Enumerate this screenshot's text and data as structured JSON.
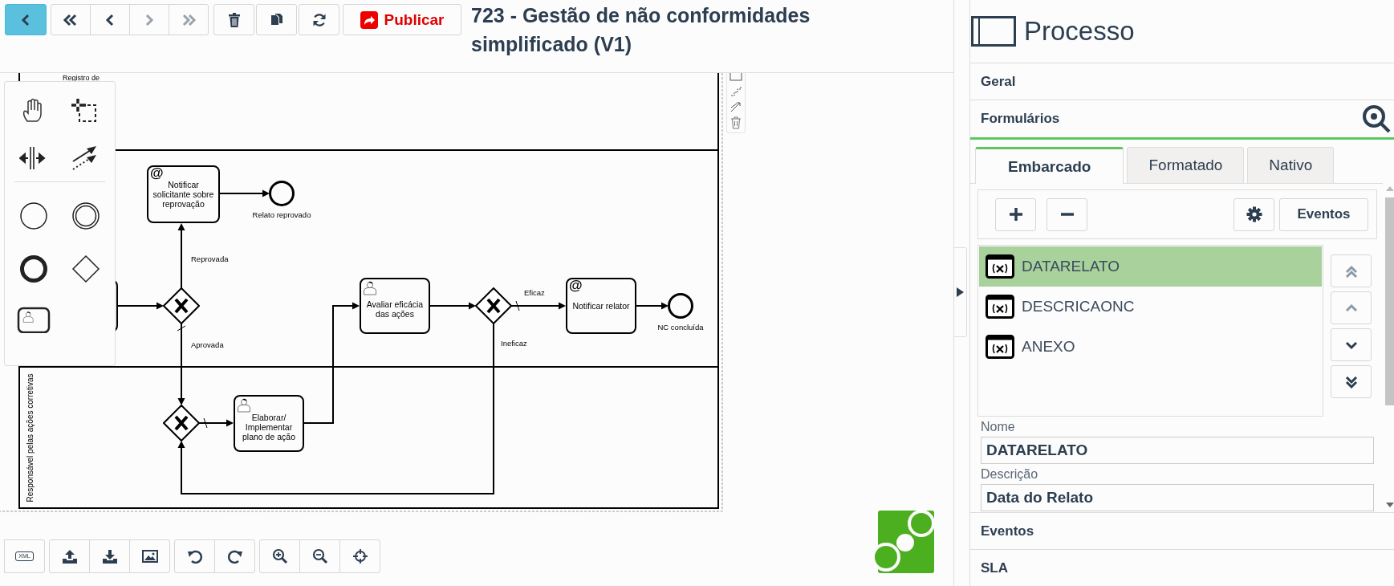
{
  "toolbar": {
    "nav_buttons": [
      {
        "kind": "first",
        "disabled": false
      },
      {
        "kind": "previous",
        "disabled": false
      },
      {
        "kind": "next",
        "disabled": true
      },
      {
        "kind": "last",
        "disabled": true
      }
    ],
    "publish_label": "Publicar"
  },
  "title": "723 - Gestão de não conformidades simplificado (V1)",
  "diagram": {
    "lanes": [
      "Registro de",
      "Responsável pelas ações corretivas"
    ],
    "nodes": [
      {
        "kind": "task"
      },
      {
        "kind": "send_task",
        "marker_text": "@",
        "label": "Notificar solicitante sobre reprovação"
      },
      {
        "kind": "end",
        "label": "Relato reprovado"
      },
      {
        "kind": "gateway"
      },
      {
        "kind": "gateway"
      },
      {
        "kind": "user_task",
        "label": "Elaborar/ Implementar plano de ação"
      },
      {
        "kind": "user_task",
        "label": "Avaliar eficácia das ações"
      },
      {
        "kind": "gateway"
      },
      {
        "kind": "send_task",
        "marker_text": "@",
        "label": "Notificar relator"
      },
      {
        "kind": "end",
        "label": "NC concluída"
      }
    ],
    "flow_labels": [
      "Reprovada",
      "Aprovada",
      "Eficaz",
      "Ineficaz"
    ]
  },
  "bottom_toolbar": {
    "xml_label": "XML"
  },
  "panel": {
    "title": "Processo",
    "sections": [
      {
        "label": "Geral",
        "expanded": false
      },
      {
        "label": "Formulários",
        "expanded": true
      },
      {
        "label": "Eventos",
        "expanded": false
      },
      {
        "label": "SLA",
        "expanded": false
      }
    ],
    "tabs": [
      {
        "label": "Embarcado",
        "selected": true
      },
      {
        "label": "Formatado",
        "selected": false
      },
      {
        "label": "Nativo",
        "selected": false
      }
    ],
    "events_button": "Eventos",
    "variables": [
      {
        "name": "DATARELATO",
        "selected": true
      },
      {
        "name": "DESCRICAONC",
        "selected": false
      },
      {
        "name": "ANEXO",
        "selected": false
      }
    ],
    "fields": [
      {
        "label": "Nome",
        "value": "DATARELATO"
      },
      {
        "label": "Descrição",
        "value": "Data do Relato"
      }
    ]
  }
}
